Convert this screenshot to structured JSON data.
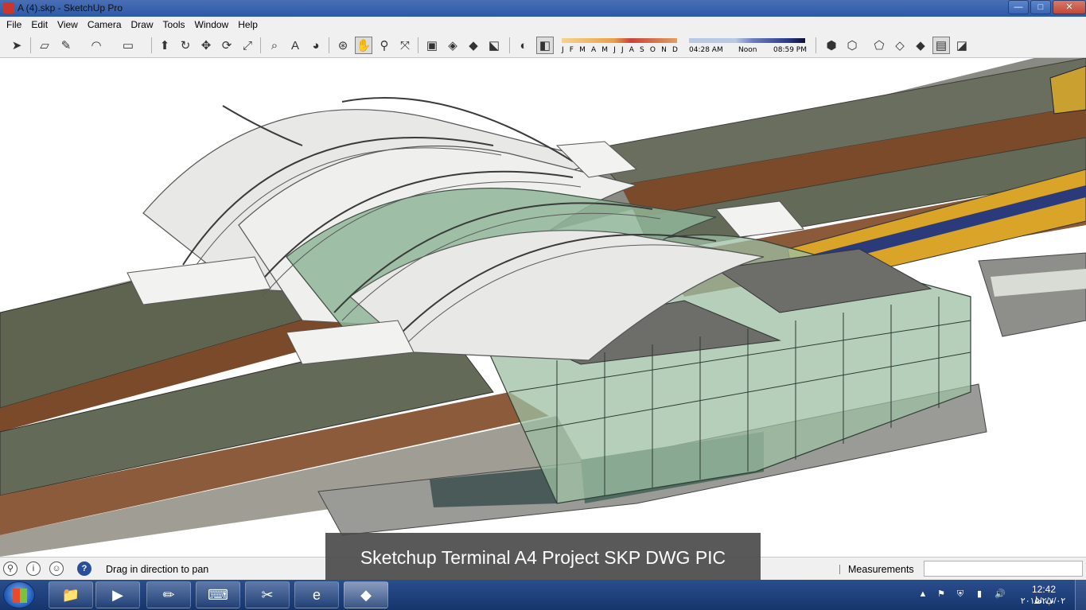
{
  "window": {
    "title": "A (4).skp - SketchUp Pro",
    "minimize_glyph": "—",
    "maximize_glyph": "□",
    "close_glyph": "✕"
  },
  "menu": [
    "File",
    "Edit",
    "View",
    "Camera",
    "Draw",
    "Tools",
    "Window",
    "Help"
  ],
  "toolbar": {
    "icons": [
      "select-icon",
      "eraser-icon",
      "pencil-icon",
      "arc-icon",
      "rectangle-icon",
      "push-pull-icon",
      "follow-me-icon",
      "move-icon",
      "rotate-icon",
      "scale-icon",
      "tape-measure-icon",
      "text-icon",
      "paint-bucket-icon",
      "orbit-icon",
      "pan-icon",
      "zoom-icon",
      "zoom-extents-icon",
      "components-icon",
      "materials-icon",
      "styles-icon",
      "add-location-icon",
      "shadows-toggle-icon",
      "shadow-settings-icon",
      "iso-view-icon",
      "top-view-icon",
      "front-view-icon",
      "right-view-icon",
      "back-view-icon",
      "xray-icon",
      "wireframe-icon"
    ],
    "months": [
      "J",
      "F",
      "M",
      "A",
      "M",
      "J",
      "J",
      "A",
      "S",
      "O",
      "N",
      "D"
    ],
    "time_start": "04:28 AM",
    "time_mid": "Noon",
    "time_end": "08:59 PM"
  },
  "status": {
    "message": "Drag in direction to pan",
    "measurements_label": "Measurements",
    "measurements_value": "",
    "help_glyph": "?",
    "info_glyph": "i"
  },
  "caption": "Sketchup Terminal A4 Project SKP DWG PIC",
  "taskbar": {
    "apps": [
      "file-explorer-icon",
      "media-player-icon",
      "paint-icon",
      "keyboard-icon",
      "snipping-tool-icon",
      "internet-explorer-icon",
      "sketchup-icon"
    ],
    "clock_time": "12:42 ب.ظ",
    "clock_date": "۲۰۱۵/۲/۷/۰۲"
  },
  "colors": {
    "roof_white": "#e8e8e6",
    "glass_green": "#8fb598",
    "platform_roof": "#646a58",
    "rail_brown": "#7a4a2a",
    "ground": "#9a9a96"
  }
}
